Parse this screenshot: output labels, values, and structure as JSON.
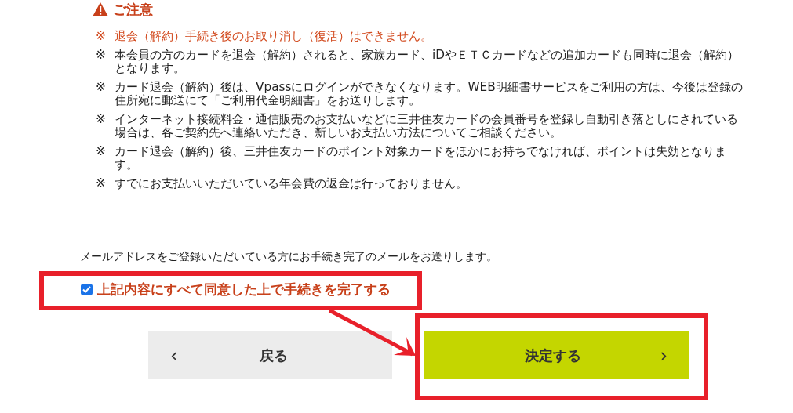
{
  "notice": {
    "title": "ご注意",
    "items": [
      {
        "mark": "※",
        "text": "退会（解約）手続き後のお取り消し（復活）はできません。",
        "highlighted": true
      },
      {
        "mark": "※",
        "text": "本会員の方のカードを退会（解約）されると、家族カード、iDやＥＴＣカードなどの追加カードも同時に退会（解約）となります。",
        "highlighted": false
      },
      {
        "mark": "※",
        "text": "カード退会（解約）後は、Vpassにログインができなくなります。WEB明細書サービスをご利用の方は、今後は登録の住所宛に郵送にて「ご利用代金明細書」をお送りします。",
        "highlighted": false
      },
      {
        "mark": "※",
        "text": "インターネット接続料金・通信販売のお支払いなどに三井住友カードの会員番号を登録し自動引き落としにされている場合は、各ご契約先へ連絡いただき、新しいお支払い方法についてご相談ください。",
        "highlighted": false
      },
      {
        "mark": "※",
        "text": "カード退会（解約）後、三井住友カードのポイント対象カードをほかにお持ちでなければ、ポイントは失効となります。",
        "highlighted": false
      },
      {
        "mark": "※",
        "text": "すでにお支払いいただいている年会費の返金は行っておりません。",
        "highlighted": false
      }
    ]
  },
  "email_note": "メールアドレスをご登録いただいている方にお手続き完了のメールをお送りします。",
  "agreement": {
    "label": "上記内容にすべて同意した上で手続きを完了する",
    "checked": true
  },
  "buttons": [
    {
      "label": "戻る",
      "kind": "back",
      "chevron": "‹"
    },
    {
      "label": "決定する",
      "kind": "submit",
      "chevron": "›"
    }
  ]
}
